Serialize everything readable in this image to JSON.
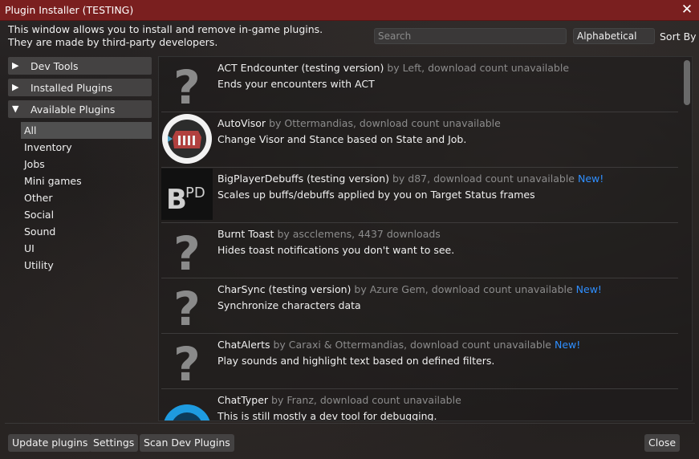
{
  "window": {
    "title": "Plugin Installer (TESTING)"
  },
  "intro": {
    "line1": "This window allows you to install and remove in-game plugins.",
    "line2": "They are made by third-party developers."
  },
  "search": {
    "placeholder": "Search",
    "value": ""
  },
  "sort": {
    "selected": "Alphabetical",
    "label": "Sort By"
  },
  "sidebar": {
    "groups": [
      {
        "label": "Dev Tools",
        "expanded": false
      },
      {
        "label": "Installed Plugins",
        "expanded": false
      },
      {
        "label": "Available Plugins",
        "expanded": true
      }
    ],
    "categories": [
      "All",
      "Inventory",
      "Jobs",
      "Mini games",
      "Other",
      "Social",
      "Sound",
      "UI",
      "Utility"
    ],
    "active_category": "All"
  },
  "plugins": [
    {
      "name": "ACT Endcounter (testing version)",
      "meta": "by Left, download count unavailable",
      "new": "",
      "desc": "Ends your encounters with ACT",
      "icon": "question-icon"
    },
    {
      "name": "AutoVisor",
      "meta": "by Ottermandias, download count unavailable",
      "new": "",
      "desc": "Change Visor and Stance based on State and Job.",
      "icon": "visor-icon"
    },
    {
      "name": "BigPlayerDebuffs (testing version)",
      "meta": "by d87, download count unavailable",
      "new": "New!",
      "desc": "Scales up buffs/debuffs applied by you on Target Status frames",
      "icon": "bpd-icon",
      "icon_text": "BPD"
    },
    {
      "name": "Burnt Toast",
      "meta": "by ascclemens, 4437 downloads",
      "new": "",
      "desc": "Hides toast notifications you don't want to see.",
      "icon": "question-icon"
    },
    {
      "name": "CharSync (testing version)",
      "meta": "by Azure Gem, download count unavailable",
      "new": "New!",
      "desc": "Synchronize characters data",
      "icon": "question-icon"
    },
    {
      "name": "ChatAlerts",
      "meta": "by Caraxi & Ottermandias, download count unavailable",
      "new": "New!",
      "desc": "Play sounds and highlight text based on defined filters.",
      "icon": "question-icon"
    },
    {
      "name": "ChatTyper",
      "meta": "by Franz, download count unavailable",
      "new": "",
      "desc": "This is still mostly a dev tool for debugging.",
      "icon": "chattyper-icon"
    }
  ],
  "buttons": {
    "update": "Update plugins",
    "settings": "Settings",
    "scan_dev": "Scan Dev Plugins",
    "close": "Close"
  },
  "colors": {
    "titlebar": "#7a1f1f",
    "new_badge": "#2f8fff",
    "meta_text": "#8c8c8c"
  }
}
